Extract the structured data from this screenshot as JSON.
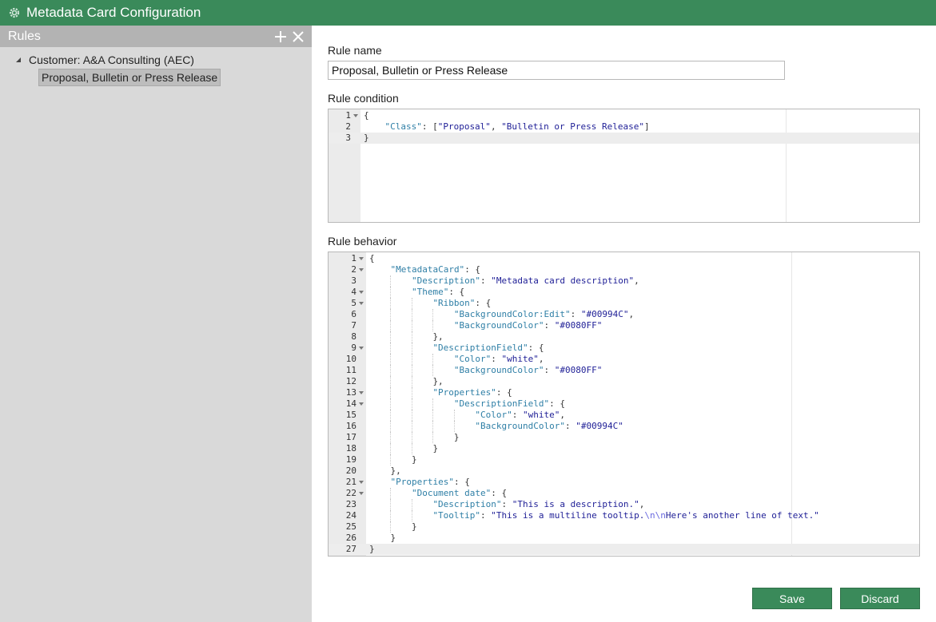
{
  "titlebar": {
    "title": "Metadata Card Configuration",
    "icon": "gear-icon"
  },
  "sidebar": {
    "header": "Rules",
    "tree": {
      "parent": "Customer: A&A Consulting (AEC)",
      "child": "Proposal, Bulletin or Press Release"
    }
  },
  "main": {
    "rule_name_label": "Rule name",
    "rule_name_value": "Proposal, Bulletin or Press Release",
    "rule_condition_label": "Rule condition",
    "rule_behavior_label": "Rule behavior"
  },
  "condition_code": [
    {
      "n": "1",
      "fold": true,
      "indent": 0,
      "tokens": [
        [
          "punc",
          "{"
        ]
      ]
    },
    {
      "n": "2",
      "fold": false,
      "indent": 1,
      "tokens": [
        [
          "key",
          "\"Class\""
        ],
        [
          "punc",
          ": ["
        ],
        [
          "str",
          "\"Proposal\""
        ],
        [
          "punc",
          ", "
        ],
        [
          "str",
          "\"Bulletin or Press Release\""
        ],
        [
          "punc",
          "]"
        ]
      ]
    },
    {
      "n": "3",
      "fold": false,
      "indent": 0,
      "tokens": [
        [
          "punc",
          "}"
        ]
      ],
      "active": true
    }
  ],
  "behavior_code": [
    {
      "n": "1",
      "fold": true,
      "indent": 0,
      "tokens": [
        [
          "punc",
          "{"
        ]
      ]
    },
    {
      "n": "2",
      "fold": true,
      "indent": 1,
      "tokens": [
        [
          "key",
          "\"MetadataCard\""
        ],
        [
          "punc",
          ": {"
        ]
      ]
    },
    {
      "n": "3",
      "fold": false,
      "indent": 2,
      "tokens": [
        [
          "key",
          "\"Description\""
        ],
        [
          "punc",
          ": "
        ],
        [
          "str",
          "\"Metadata card description\""
        ],
        [
          "punc",
          ","
        ]
      ]
    },
    {
      "n": "4",
      "fold": true,
      "indent": 2,
      "tokens": [
        [
          "key",
          "\"Theme\""
        ],
        [
          "punc",
          ": {"
        ]
      ]
    },
    {
      "n": "5",
      "fold": true,
      "indent": 3,
      "tokens": [
        [
          "key",
          "\"Ribbon\""
        ],
        [
          "punc",
          ": {"
        ]
      ]
    },
    {
      "n": "6",
      "fold": false,
      "indent": 4,
      "tokens": [
        [
          "key",
          "\"BackgroundColor:Edit\""
        ],
        [
          "punc",
          ": "
        ],
        [
          "str",
          "\"#00994C\""
        ],
        [
          "punc",
          ","
        ]
      ]
    },
    {
      "n": "7",
      "fold": false,
      "indent": 4,
      "tokens": [
        [
          "key",
          "\"BackgroundColor\""
        ],
        [
          "punc",
          ": "
        ],
        [
          "str",
          "\"#0080FF\""
        ]
      ]
    },
    {
      "n": "8",
      "fold": false,
      "indent": 3,
      "tokens": [
        [
          "punc",
          "},"
        ]
      ]
    },
    {
      "n": "9",
      "fold": true,
      "indent": 3,
      "tokens": [
        [
          "key",
          "\"DescriptionField\""
        ],
        [
          "punc",
          ": {"
        ]
      ]
    },
    {
      "n": "10",
      "fold": false,
      "indent": 4,
      "tokens": [
        [
          "key",
          "\"Color\""
        ],
        [
          "punc",
          ": "
        ],
        [
          "str",
          "\"white\""
        ],
        [
          "punc",
          ","
        ]
      ]
    },
    {
      "n": "11",
      "fold": false,
      "indent": 4,
      "tokens": [
        [
          "key",
          "\"BackgroundColor\""
        ],
        [
          "punc",
          ": "
        ],
        [
          "str",
          "\"#0080FF\""
        ]
      ]
    },
    {
      "n": "12",
      "fold": false,
      "indent": 3,
      "tokens": [
        [
          "punc",
          "},"
        ]
      ]
    },
    {
      "n": "13",
      "fold": true,
      "indent": 3,
      "tokens": [
        [
          "key",
          "\"Properties\""
        ],
        [
          "punc",
          ": {"
        ]
      ]
    },
    {
      "n": "14",
      "fold": true,
      "indent": 4,
      "tokens": [
        [
          "key",
          "\"DescriptionField\""
        ],
        [
          "punc",
          ": {"
        ]
      ]
    },
    {
      "n": "15",
      "fold": false,
      "indent": 5,
      "tokens": [
        [
          "key",
          "\"Color\""
        ],
        [
          "punc",
          ": "
        ],
        [
          "str",
          "\"white\""
        ],
        [
          "punc",
          ","
        ]
      ]
    },
    {
      "n": "16",
      "fold": false,
      "indent": 5,
      "tokens": [
        [
          "key",
          "\"BackgroundColor\""
        ],
        [
          "punc",
          ": "
        ],
        [
          "str",
          "\"#00994C\""
        ]
      ]
    },
    {
      "n": "17",
      "fold": false,
      "indent": 4,
      "tokens": [
        [
          "punc",
          "}"
        ]
      ]
    },
    {
      "n": "18",
      "fold": false,
      "indent": 3,
      "tokens": [
        [
          "punc",
          "}"
        ]
      ]
    },
    {
      "n": "19",
      "fold": false,
      "indent": 2,
      "tokens": [
        [
          "punc",
          "}"
        ]
      ]
    },
    {
      "n": "20",
      "fold": false,
      "indent": 1,
      "tokens": [
        [
          "punc",
          "},"
        ]
      ]
    },
    {
      "n": "21",
      "fold": true,
      "indent": 1,
      "tokens": [
        [
          "key",
          "\"Properties\""
        ],
        [
          "punc",
          ": {"
        ]
      ]
    },
    {
      "n": "22",
      "fold": true,
      "indent": 2,
      "tokens": [
        [
          "key",
          "\"Document date\""
        ],
        [
          "punc",
          ": {"
        ]
      ]
    },
    {
      "n": "23",
      "fold": false,
      "indent": 3,
      "tokens": [
        [
          "key",
          "\"Description\""
        ],
        [
          "punc",
          ": "
        ],
        [
          "str",
          "\"This is a description.\""
        ],
        [
          "punc",
          ","
        ]
      ]
    },
    {
      "n": "24",
      "fold": false,
      "indent": 3,
      "tokens": [
        [
          "key",
          "\"Tooltip\""
        ],
        [
          "punc",
          ": "
        ],
        [
          "str",
          "\"This is a multiline tooltip."
        ],
        [
          "esc",
          "\\n\\n"
        ],
        [
          "str",
          "Here's another line of text.\""
        ]
      ]
    },
    {
      "n": "25",
      "fold": false,
      "indent": 2,
      "tokens": [
        [
          "punc",
          "}"
        ]
      ]
    },
    {
      "n": "26",
      "fold": false,
      "indent": 1,
      "tokens": [
        [
          "punc",
          "}"
        ]
      ]
    },
    {
      "n": "27",
      "fold": false,
      "indent": 0,
      "tokens": [
        [
          "punc",
          "}"
        ]
      ],
      "active": true
    }
  ],
  "buttons": {
    "save": "Save",
    "discard": "Discard"
  },
  "colors": {
    "accent": "#3a8a5a",
    "sidebar": "#d9d9d9",
    "sidebar_header": "#b3b3b3"
  }
}
